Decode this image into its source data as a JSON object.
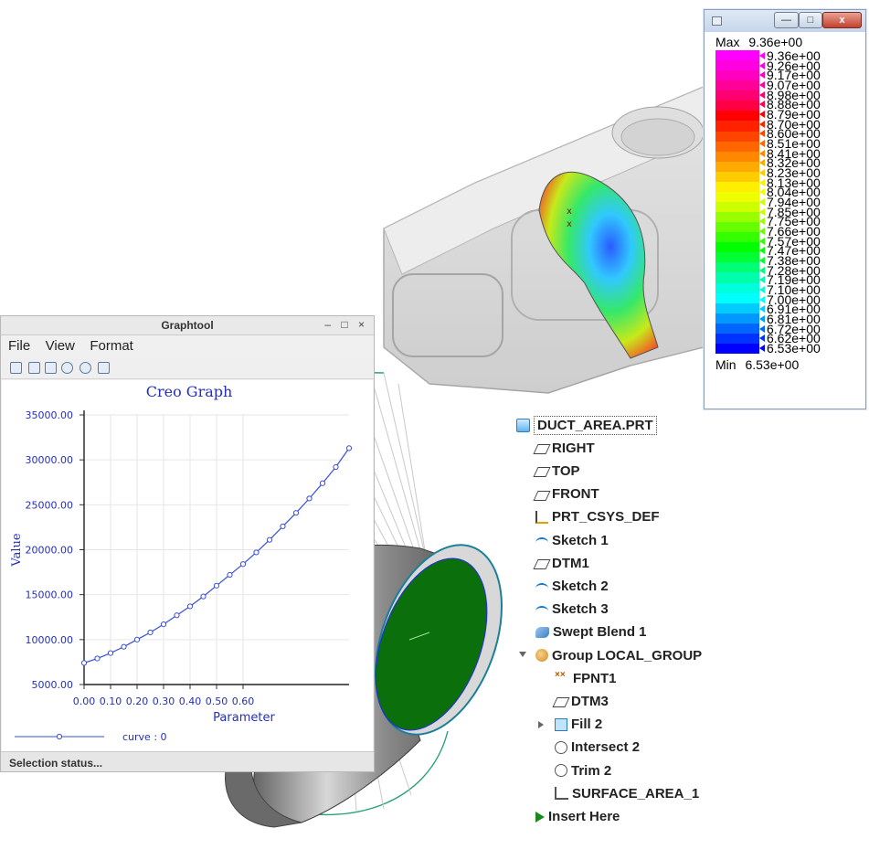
{
  "legend_window": {
    "max_label": "Max",
    "max_value": "9.36e+00",
    "min_label": "Min",
    "min_value": "6.53e+00",
    "ticks": [
      "9.36e+00",
      "9.26e+00",
      "9.17e+00",
      "9.07e+00",
      "8.98e+00",
      "8.88e+00",
      "8.79e+00",
      "8.70e+00",
      "8.60e+00",
      "8.51e+00",
      "8.41e+00",
      "8.32e+00",
      "8.23e+00",
      "8.13e+00",
      "8.04e+00",
      "7.94e+00",
      "7.85e+00",
      "7.75e+00",
      "7.66e+00",
      "7.57e+00",
      "7.47e+00",
      "7.38e+00",
      "7.28e+00",
      "7.19e+00",
      "7.10e+00",
      "7.00e+00",
      "6.91e+00",
      "6.81e+00",
      "6.72e+00",
      "6.62e+00",
      "6.53e+00"
    ],
    "colors": [
      "#ff00ff",
      "#ff00e0",
      "#ff00c0",
      "#ff0099",
      "#ff0070",
      "#ff0044",
      "#ff0000",
      "#ff2200",
      "#ff4400",
      "#ff6600",
      "#ff8800",
      "#ffaa00",
      "#ffcc00",
      "#ffee00",
      "#eeff00",
      "#ccff00",
      "#99ff00",
      "#66ff00",
      "#33ff00",
      "#00ff00",
      "#00ff33",
      "#00ff77",
      "#00ffaa",
      "#00ffdd",
      "#00ffff",
      "#00ccff",
      "#0099ff",
      "#0066ff",
      "#0033ff",
      "#0000ff"
    ],
    "close_glyph": "x",
    "min_glyph": "—",
    "max_glyph": "□"
  },
  "graphtool": {
    "title": "Graphtool",
    "controls": "– □ ×",
    "menu": [
      "File",
      "View",
      "Format"
    ],
    "status": "Selection status...",
    "toolbar_icons": [
      "print-icon",
      "grid-icon",
      "edit-icon",
      "zoom-in-icon",
      "zoom-fit-icon",
      "export-icon"
    ]
  },
  "chart_data": {
    "type": "line",
    "title": "Creo Graph",
    "xlabel": "Parameter",
    "ylabel": "Value",
    "ylim": [
      5000,
      35000
    ],
    "xlim": [
      0,
      1.0
    ],
    "yticks": [
      "5000.00",
      "10000.00",
      "15000.00",
      "20000.00",
      "25000.00",
      "30000.00",
      "35000.00"
    ],
    "xticks": [
      "0.00",
      "0.10",
      "0.20",
      "0.30",
      "0.40",
      "0.50",
      "0.60"
    ],
    "grid": true,
    "legend": "bottom-left",
    "series": [
      {
        "name": "curve : 0",
        "color": "#3a4fd6",
        "x": [
          0.0,
          0.05,
          0.1,
          0.15,
          0.2,
          0.25,
          0.3,
          0.35,
          0.4,
          0.45,
          0.5,
          0.55,
          0.6,
          0.65,
          0.7,
          0.75,
          0.8,
          0.85,
          0.9,
          0.95,
          1.0
        ],
        "y": [
          7400,
          7900,
          8500,
          9200,
          10000,
          10800,
          11700,
          12700,
          13700,
          14800,
          16000,
          17200,
          18400,
          19700,
          21100,
          22600,
          24100,
          25700,
          27400,
          29200,
          31300
        ]
      }
    ]
  },
  "model_tree": [
    {
      "label": "DUCT_AREA.PRT",
      "icon": "part-icon"
    },
    {
      "label": "RIGHT",
      "icon": "datum-plane-icon"
    },
    {
      "label": "TOP",
      "icon": "datum-plane-icon"
    },
    {
      "label": "FRONT",
      "icon": "datum-plane-icon"
    },
    {
      "label": "PRT_CSYS_DEF",
      "icon": "csys-icon"
    },
    {
      "label": "Sketch 1",
      "icon": "sketch-icon"
    },
    {
      "label": "DTM1",
      "icon": "datum-plane-icon"
    },
    {
      "label": "Sketch 2",
      "icon": "sketch-icon"
    },
    {
      "label": "Sketch 3",
      "icon": "sketch-icon"
    },
    {
      "label": "Swept Blend 1",
      "icon": "swept-blend-icon"
    },
    {
      "label": "Group LOCAL_GROUP",
      "icon": "group-icon"
    },
    {
      "label": "FPNT1",
      "icon": "datum-point-icon"
    },
    {
      "label": "DTM3",
      "icon": "datum-plane-icon"
    },
    {
      "label": "Fill 2",
      "icon": "fill-icon"
    },
    {
      "label": "Intersect 2",
      "icon": "intersect-icon"
    },
    {
      "label": "Trim 2",
      "icon": "trim-icon"
    },
    {
      "label": "SURFACE_AREA_1",
      "icon": "analysis-icon"
    },
    {
      "label": "Insert Here",
      "icon": "insert-arrow-icon"
    }
  ]
}
